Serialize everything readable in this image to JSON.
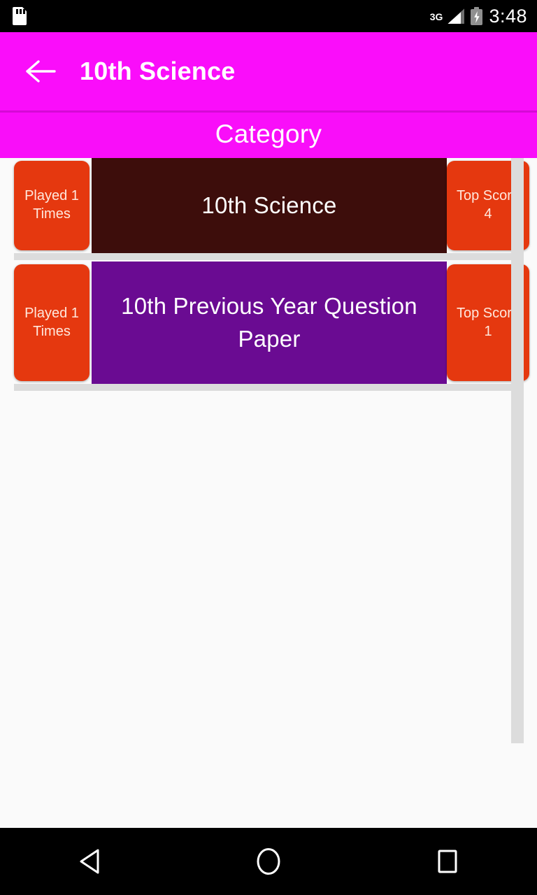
{
  "status_bar": {
    "sd_icon": "sd-card-icon",
    "network_type": "3G",
    "signal_icon": "signal-bars-icon",
    "battery_icon": "battery-charging-icon",
    "time": "3:48"
  },
  "app_bar": {
    "back_icon": "back-arrow-icon",
    "title": "10th Science",
    "background": "#fa0dfa"
  },
  "category_header": {
    "label": "Category",
    "background": "#f90ef9"
  },
  "list": {
    "rows": [
      {
        "played_label": "Played 1",
        "played_sub": "Times",
        "title": "10th Science",
        "top_score_label": "Top Score",
        "top_score_value": "4",
        "background": "#3d0d0b"
      },
      {
        "played_label": "Played 1",
        "played_sub": "Times",
        "title": "10th Previous Year Question Paper",
        "top_score_label": "Top Score",
        "top_score_value": "1",
        "background": "#6a0b92"
      }
    ],
    "badge_color": "#e5380f"
  },
  "nav_bar": {
    "back_icon": "nav-back-triangle-icon",
    "home_icon": "nav-home-circle-icon",
    "recents_icon": "nav-recents-square-icon"
  }
}
